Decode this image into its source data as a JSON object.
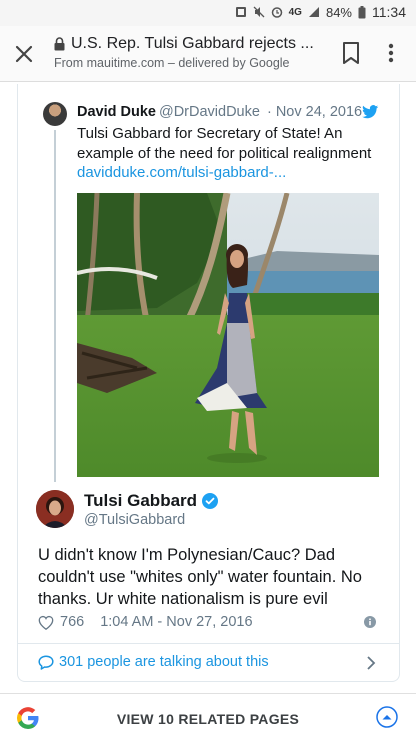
{
  "status_bar": {
    "network": "4G",
    "battery": "84%",
    "time": "11:34"
  },
  "app_bar": {
    "title": "U.S. Rep. Tulsi Gabbard rejects ...",
    "subtitle": "From mauitime.com – delivered by Google"
  },
  "quoted_tweet": {
    "name": "David Duke",
    "handle": "@DrDavidDuke",
    "date": "· Nov 24, 2016",
    "text": "Tulsi Gabbard for Secretary of State! An example of the need for political realignment",
    "link": "davidduke.com/tulsi-gabbard-..."
  },
  "tweet": {
    "name": "Tulsi Gabbard",
    "handle": "@TulsiGabbard",
    "text": "U didn't know I'm Polynesian/Cauc? Dad couldn't use \"whites only\" water fountain. No thanks. Ur white nationalism is pure evil",
    "likes": "766",
    "timestamp": "1:04 AM - Nov 27, 2016"
  },
  "conversation": {
    "label": "301 people are talking about this"
  },
  "bottom_bar": {
    "label": "VIEW 10 RELATED PAGES"
  },
  "colors": {
    "twitter_blue": "#1b95e0",
    "verified_blue": "#1da1f2",
    "secondary_text": "#657786"
  },
  "icons": [
    "close-icon",
    "lock-icon",
    "bookmark-icon",
    "more-vert-icon",
    "twitter-bird-icon",
    "verified-icon",
    "heart-icon",
    "info-icon",
    "chat-bubble-icon",
    "chevron-right-icon",
    "google-logo-icon",
    "chevron-up-icon"
  ]
}
